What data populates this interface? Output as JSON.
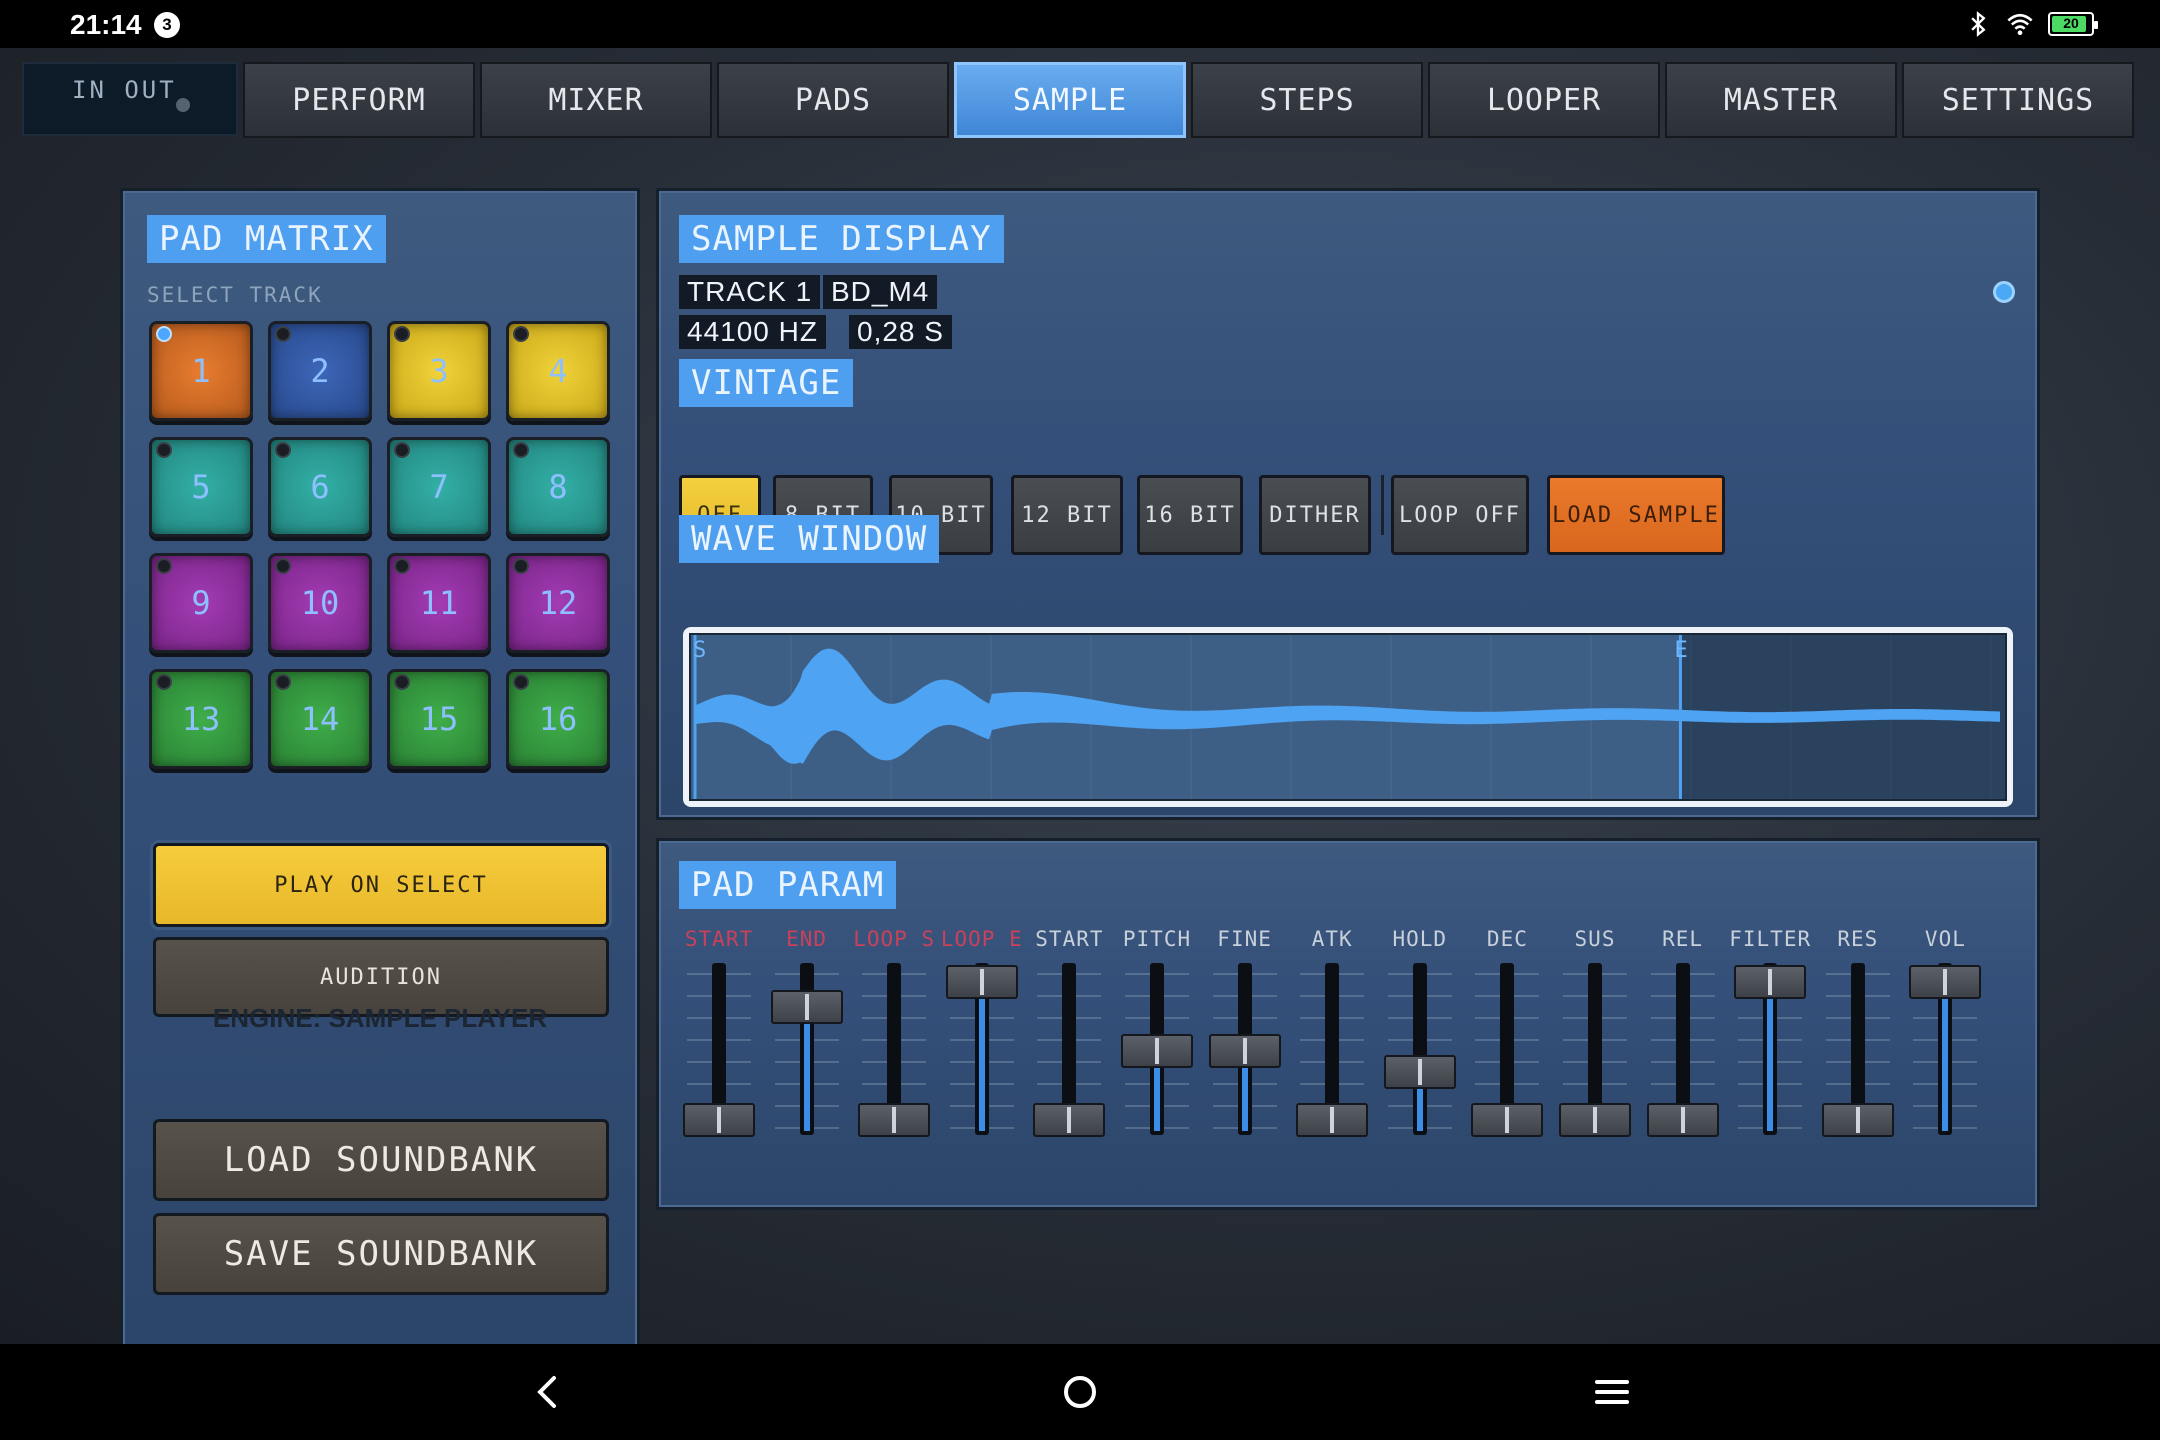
{
  "status_bar": {
    "time": "21:14",
    "notification_count": "3",
    "battery": "20"
  },
  "io": {
    "label": "IN OUT"
  },
  "tabs": [
    {
      "label": "PERFORM",
      "active": false
    },
    {
      "label": "MIXER",
      "active": false
    },
    {
      "label": "PADS",
      "active": false
    },
    {
      "label": "SAMPLE",
      "active": true
    },
    {
      "label": "STEPS",
      "active": false
    },
    {
      "label": "LOOPER",
      "active": false
    },
    {
      "label": "MASTER",
      "active": false
    },
    {
      "label": "SETTINGS",
      "active": false
    }
  ],
  "pad_matrix": {
    "title": "PAD MATRIX",
    "subtitle": "SELECT TRACK",
    "pads": [
      {
        "label": "1",
        "color": "orange",
        "selected": true
      },
      {
        "label": "2",
        "color": "blue",
        "selected": false
      },
      {
        "label": "3",
        "color": "yellow",
        "selected": false
      },
      {
        "label": "4",
        "color": "yellow",
        "selected": false
      },
      {
        "label": "5",
        "color": "teal",
        "selected": false
      },
      {
        "label": "6",
        "color": "teal",
        "selected": false
      },
      {
        "label": "7",
        "color": "teal",
        "selected": false
      },
      {
        "label": "8",
        "color": "teal",
        "selected": false
      },
      {
        "label": "9",
        "color": "purple",
        "selected": false
      },
      {
        "label": "10",
        "color": "purple",
        "selected": false
      },
      {
        "label": "11",
        "color": "purple",
        "selected": false
      },
      {
        "label": "12",
        "color": "purple",
        "selected": false
      },
      {
        "label": "13",
        "color": "green",
        "selected": false
      },
      {
        "label": "14",
        "color": "green",
        "selected": false
      },
      {
        "label": "15",
        "color": "green",
        "selected": false
      },
      {
        "label": "16",
        "color": "green",
        "selected": false
      }
    ],
    "play_on_select": "PLAY ON SELECT",
    "audition": "AUDITION",
    "engine": "ENGINE: SAMPLE PLAYER",
    "load_soundbank": "LOAD SOUNDBANK",
    "save_soundbank": "SAVE SOUNDBANK"
  },
  "sample_display": {
    "title": "SAMPLE DISPLAY",
    "track": "TRACK 1",
    "sample_name": "BD_M4",
    "sample_rate": "44100 HZ",
    "length": "0,28 S",
    "vintage_title": "VINTAGE",
    "vintage_buttons": [
      {
        "label": "OFF",
        "active": true
      },
      {
        "label": "8 BIT",
        "active": false
      },
      {
        "label": "10 BIT",
        "active": false
      },
      {
        "label": "12 BIT",
        "active": false
      },
      {
        "label": "16 BIT",
        "active": false
      },
      {
        "label": "DITHER",
        "active": false
      }
    ],
    "loop_button": "LOOP OFF",
    "load_sample": "LOAD SAMPLE",
    "wave_title": "WAVE WINDOW",
    "start_marker": "S",
    "end_marker": "E",
    "end_position": 0.753
  },
  "pad_param": {
    "title": "PAD PARAM",
    "sliders": [
      {
        "label": "START",
        "disabled": true,
        "level": 0.0
      },
      {
        "label": "END",
        "disabled": true,
        "level": 0.82
      },
      {
        "label": "LOOP S",
        "disabled": true,
        "level": 0.0
      },
      {
        "label": "LOOP E",
        "disabled": true,
        "level": 1.0
      },
      {
        "label": "START",
        "disabled": false,
        "level": 0.0
      },
      {
        "label": "PITCH",
        "disabled": false,
        "level": 0.5
      },
      {
        "label": "FINE",
        "disabled": false,
        "level": 0.5
      },
      {
        "label": "ATK",
        "disabled": false,
        "level": 0.0
      },
      {
        "label": "HOLD",
        "disabled": false,
        "level": 0.35
      },
      {
        "label": "DEC",
        "disabled": false,
        "level": 0.0
      },
      {
        "label": "SUS",
        "disabled": false,
        "level": 0.0
      },
      {
        "label": "REL",
        "disabled": false,
        "level": 0.0
      },
      {
        "label": "FILTER",
        "disabled": false,
        "level": 1.0
      },
      {
        "label": "RES",
        "disabled": false,
        "level": 0.0
      },
      {
        "label": "VOL",
        "disabled": false,
        "level": 1.0
      }
    ]
  },
  "nav_icons": [
    "back-icon",
    "home-icon",
    "menu-icon"
  ]
}
